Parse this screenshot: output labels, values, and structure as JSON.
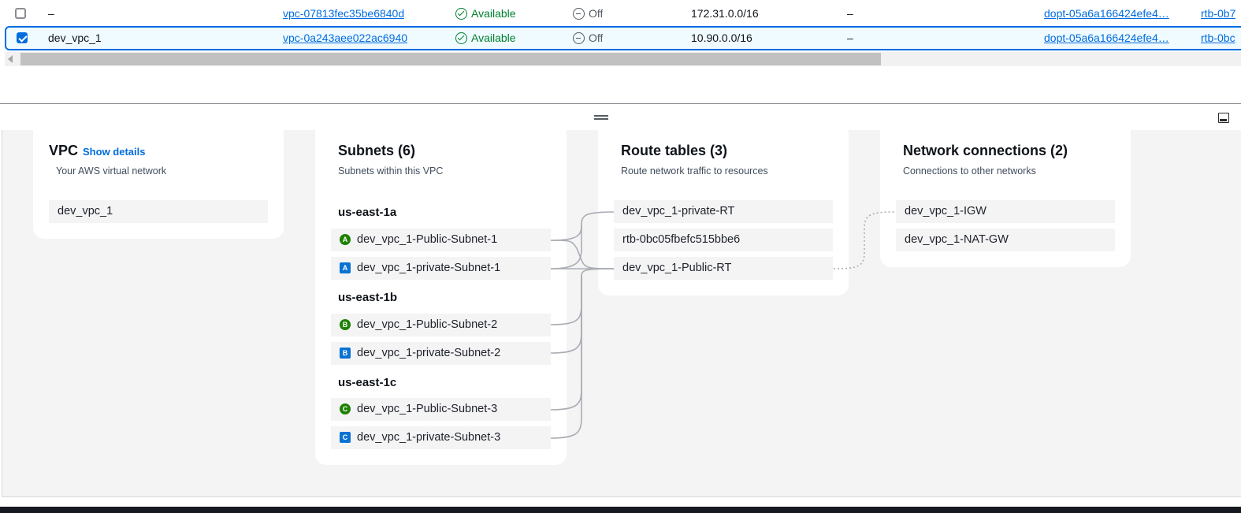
{
  "table": {
    "rows": [
      {
        "checked": false,
        "name": "–",
        "vpc_id": "vpc-07813fec35be6840d",
        "state": "Available",
        "block_public_access": "Off",
        "ipv4_cidr": "172.31.0.0/16",
        "ipv6_cidr": "–",
        "dhcp_option_set": "dopt-05a6a166424efe4…",
        "main_route_table": "rtb-0b7"
      },
      {
        "checked": true,
        "name": "dev_vpc_1",
        "vpc_id": "vpc-0a243aee022ac6940",
        "state": "Available",
        "block_public_access": "Off",
        "ipv4_cidr": "10.90.0.0/16",
        "ipv6_cidr": "–",
        "dhcp_option_set": "dopt-05a6a166424efe4…",
        "main_route_table": "rtb-0bc"
      }
    ]
  },
  "resource_map": {
    "vpc": {
      "title": "VPC",
      "show_details": "Show details",
      "subtitle": "Your AWS virtual network",
      "name": "dev_vpc_1"
    },
    "subnets": {
      "title": "Subnets (6)",
      "subtitle": "Subnets within this VPC",
      "zones": [
        {
          "name": "us-east-1a",
          "items": [
            {
              "badge": "A",
              "kind": "public",
              "label": "dev_vpc_1-Public-Subnet-1"
            },
            {
              "badge": "A",
              "kind": "private",
              "label": "dev_vpc_1-private-Subnet-1"
            }
          ]
        },
        {
          "name": "us-east-1b",
          "items": [
            {
              "badge": "B",
              "kind": "public",
              "label": "dev_vpc_1-Public-Subnet-2"
            },
            {
              "badge": "B",
              "kind": "private",
              "label": "dev_vpc_1-private-Subnet-2"
            }
          ]
        },
        {
          "name": "us-east-1c",
          "items": [
            {
              "badge": "C",
              "kind": "public",
              "label": "dev_vpc_1-Public-Subnet-3"
            },
            {
              "badge": "C",
              "kind": "private",
              "label": "dev_vpc_1-private-Subnet-3"
            }
          ]
        }
      ]
    },
    "route_tables": {
      "title": "Route tables (3)",
      "subtitle": "Route network traffic to resources",
      "items": [
        "dev_vpc_1-private-RT",
        "rtb-0bc05fbefc515bbe6",
        "dev_vpc_1-Public-RT"
      ]
    },
    "network_connections": {
      "title": "Network connections (2)",
      "subtitle": "Connections to other networks",
      "items": [
        "dev_vpc_1-IGW",
        "dev_vpc_1-NAT-GW"
      ]
    }
  },
  "colors": {
    "link": "#006ce0",
    "available": "#00802f",
    "selected_row_border": "#006ce0",
    "public_badge": "#1d8102",
    "private_badge": "#0972d3"
  }
}
